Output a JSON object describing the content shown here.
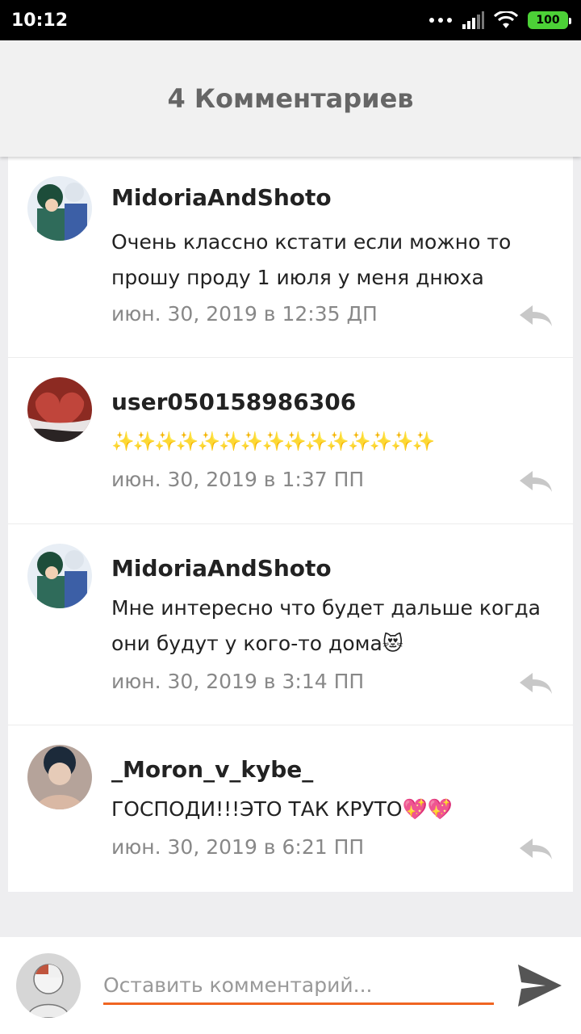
{
  "status_bar": {
    "time": "10:12",
    "battery": "100"
  },
  "header": {
    "title": "4 Комментариев"
  },
  "comments": [
    {
      "username": "MidoriaAndShoto",
      "text": "Очень классно кстати если можно то прошу проду 1 июля у меня днюха",
      "date": "июн. 30, 2019 в 12:35 ДП"
    },
    {
      "username": "user050158986306",
      "text": "✨✨✨✨✨✨✨✨✨✨✨✨✨✨✨",
      "date": "июн. 30, 2019 в 1:37 ПП"
    },
    {
      "username": "MidoriaAndShoto",
      "text": "Мне интересно что будет дальше когда они будут у кого-то дома😻",
      "date": "июн. 30, 2019 в 3:14 ПП"
    },
    {
      "username": "_Moron_v_kybe_",
      "text": "ГОСПОДИ!!!ЭТО ТАК КРУТО💖💖",
      "date": "июн. 30, 2019 в 6:21 ПП"
    }
  ],
  "input": {
    "placeholder": "Оставить комментарий..."
  },
  "colors": {
    "accent": "#f06522",
    "battery": "#4cd137"
  }
}
